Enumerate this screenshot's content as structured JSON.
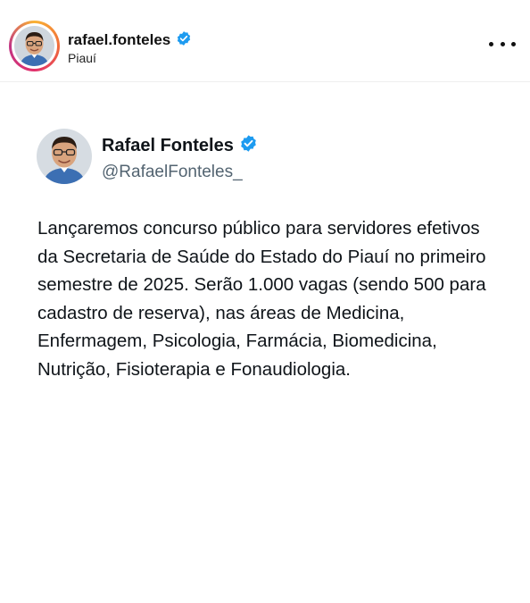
{
  "post": {
    "username": "rafael.fonteles",
    "location": "Piauí",
    "verified": true
  },
  "tweet": {
    "author_name": "Rafael Fonteles",
    "author_handle": "@RafaelFonteles_",
    "verified": true,
    "text": "Lançaremos concurso público para servidores efetivos da Secretaria de Saúde do Estado do Piauí no primeiro semestre de 2025. Serão 1.000 vagas (sendo 500 para cadastro de reserva), nas áreas de Medicina, Enfermagem, Psicologia, Farmácia, Biomedicina, Nutrição, Fisioterapia e Fonaudiologia."
  },
  "icons": {
    "verified_badge": "verified-badge-icon",
    "more_options": "more-options-icon"
  },
  "colors": {
    "verified_blue": "#1d9bf0",
    "handle_gray": "#536471",
    "text": "#0f1419"
  }
}
